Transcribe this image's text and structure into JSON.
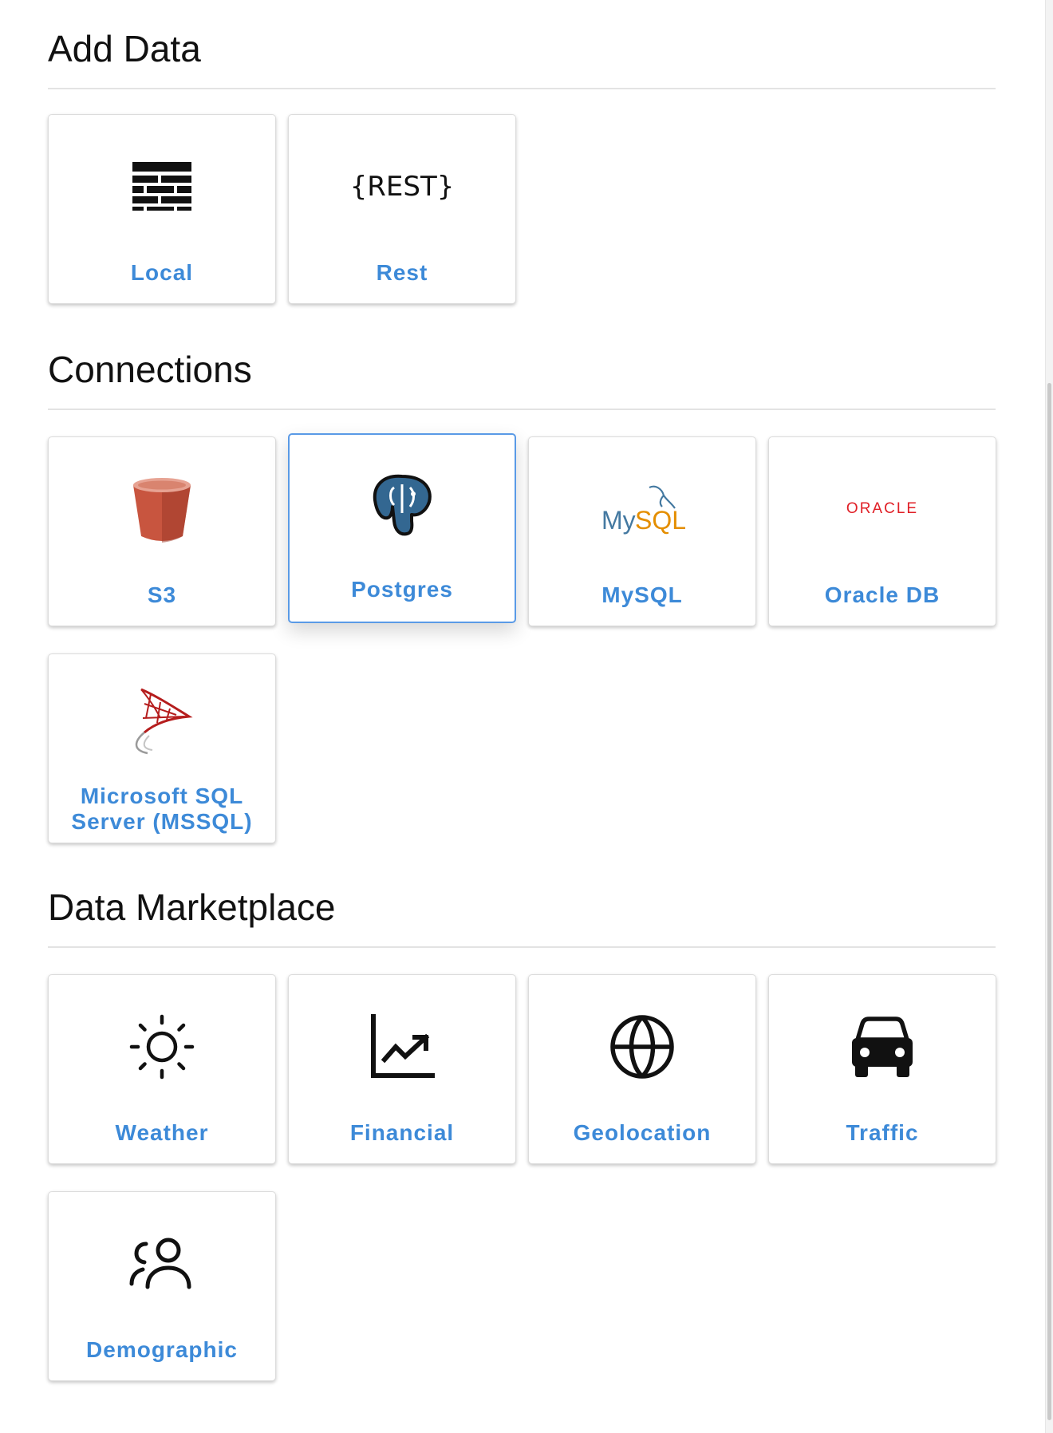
{
  "add_data": {
    "title": "Add Data",
    "cards": [
      {
        "label": "Local",
        "icon": "brick-wall-icon"
      },
      {
        "label": "Rest",
        "icon": "rest-icon",
        "icon_text": "{REST}"
      }
    ]
  },
  "connections": {
    "title": "Connections",
    "selected": "Postgres",
    "cards": [
      {
        "label": "S3",
        "icon": "s3-bucket-icon"
      },
      {
        "label": "Postgres",
        "icon": "postgres-elephant-icon"
      },
      {
        "label": "MySQL",
        "icon": "mysql-logo-icon",
        "icon_text": "MySQL"
      },
      {
        "label": "Oracle DB",
        "icon": "oracle-logo-icon",
        "icon_text": "ORACLE"
      },
      {
        "label": "Microsoft SQL Server (MSSQL)",
        "icon": "mssql-logo-icon"
      }
    ]
  },
  "marketplace": {
    "title": "Data Marketplace",
    "cards": [
      {
        "label": "Weather",
        "icon": "sun-icon"
      },
      {
        "label": "Financial",
        "icon": "trending-chart-icon"
      },
      {
        "label": "Geolocation",
        "icon": "globe-icon"
      },
      {
        "label": "Traffic",
        "icon": "car-icon"
      },
      {
        "label": "Demographic",
        "icon": "people-icon"
      }
    ]
  },
  "colors": {
    "accent": "#3d8ad8",
    "selected_border": "#5a9ae6",
    "divider": "#e3e3e3",
    "s3": "#c8553f",
    "postgres": "#336791",
    "mysql_blue": "#4479a1",
    "mysql_orange": "#e48e00",
    "oracle_red": "#e01f26",
    "mssql_red": "#b51d1d"
  }
}
